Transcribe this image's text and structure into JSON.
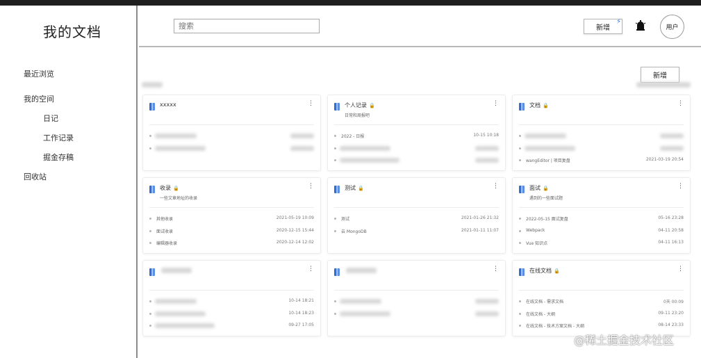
{
  "app": {
    "title": "我的文档"
  },
  "sidebar": {
    "items": [
      {
        "label": "最近浏览"
      },
      {
        "label": "我的空间"
      },
      {
        "label": "日记"
      },
      {
        "label": "工作记录"
      },
      {
        "label": "掘金存稿"
      },
      {
        "label": "回收站"
      }
    ]
  },
  "header": {
    "search_placeholder": "搜索",
    "new_label": "新增",
    "user_label": "用户"
  },
  "main": {
    "new_label": "新增"
  },
  "cards": [
    {
      "title": "xxxxx",
      "lock": false,
      "desc": "",
      "rows": [
        {
          "name": "",
          "time": ""
        },
        {
          "name": "",
          "time": ""
        }
      ]
    },
    {
      "title": "个人记录",
      "lock": true,
      "desc": "日常和周报吧",
      "rows": [
        {
          "name": "2022 - 日报",
          "time": "10-15 10:18"
        },
        {
          "name": "",
          "time": ""
        },
        {
          "name": "",
          "time": ""
        }
      ]
    },
    {
      "title": "文档",
      "lock": true,
      "desc": "",
      "rows": [
        {
          "name": "",
          "time": ""
        },
        {
          "name": "",
          "time": ""
        },
        {
          "name": "wangEditor | 项目复盘",
          "time": "2021-03-19 20:54"
        }
      ]
    },
    {
      "title": "收录",
      "lock": true,
      "desc": "一些文章地址的收录",
      "rows": [
        {
          "name": "其他收录",
          "time": "2021-05-19 10:09"
        },
        {
          "name": "面试收录",
          "time": "2020-12-15 15:44"
        },
        {
          "name": "编辑器收录",
          "time": "2020-12-14 12:02"
        }
      ]
    },
    {
      "title": "测试",
      "lock": true,
      "desc": "",
      "rows": [
        {
          "name": "测试",
          "time": "2021-01-26 21:32"
        },
        {
          "name": "云 MongoDB",
          "time": "2021-01-11 11:07"
        }
      ]
    },
    {
      "title": "面试",
      "lock": true,
      "desc": "遇到的一些面试题",
      "rows": [
        {
          "name": "2022-05-15 面试复盘",
          "time": "05-16 23:28"
        },
        {
          "name": "Webpack",
          "time": "04-11 20:58"
        },
        {
          "name": "Vue 知识点",
          "time": "04-11 16:13"
        }
      ]
    },
    {
      "title": "",
      "lock": false,
      "desc": "",
      "rows": [
        {
          "name": "",
          "time": "10-14 18:21"
        },
        {
          "name": "",
          "time": "10-14 18:23"
        },
        {
          "name": "",
          "time": "09-27 17:05"
        }
      ]
    },
    {
      "title": "",
      "lock": false,
      "desc": "",
      "rows": [
        {
          "name": "",
          "time": ""
        },
        {
          "name": "",
          "time": ""
        }
      ]
    },
    {
      "title": "在线文档",
      "lock": true,
      "desc": "",
      "rows": [
        {
          "name": "在线文档 - 需求文档",
          "time": "0天 00:09"
        },
        {
          "name": "在线文档 - 大纲",
          "time": "09-11 23:20"
        },
        {
          "name": "在线文档 - 技术方案文档 - 大纲",
          "time": "08-14 23:33"
        }
      ]
    }
  ],
  "watermark": {
    "text": "@稀土掘金技术社区"
  }
}
